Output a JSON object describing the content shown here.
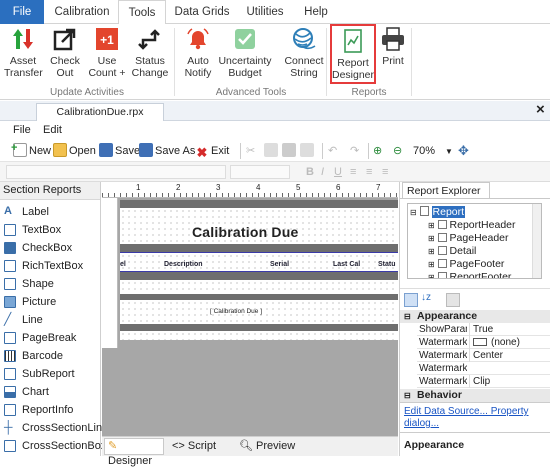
{
  "ribbon_tabs": [
    "File",
    "Calibration",
    "Tools",
    "Data Grids",
    "Utilities",
    "Help"
  ],
  "update_activities": {
    "buttons": [
      {
        "label1": "Asset",
        "label2": "Transfer",
        "icon": "up-down-arrows-icon"
      },
      {
        "label1": "Check",
        "label2": "Out",
        "icon": "check-out-icon"
      },
      {
        "label1": "Use",
        "label2": "Count +",
        "icon": "plus-one-icon"
      },
      {
        "label1": "Status",
        "label2": "Change",
        "icon": "status-change-icon"
      }
    ],
    "group_label": "Update Activities"
  },
  "advanced_tools": {
    "buttons": [
      {
        "label1": "Auto",
        "label2": "Notify",
        "icon": "bell-icon"
      },
      {
        "label1": "Uncertainty",
        "label2": "Budget",
        "icon": "budget-check-icon"
      },
      {
        "label1": "Connect",
        "label2": "String",
        "icon": "connect-string-icon"
      }
    ],
    "group_label": "Advanced Tools"
  },
  "reports": {
    "buttons": [
      {
        "label1": "Report",
        "label2": "Designer",
        "icon": "report-designer-icon"
      },
      {
        "label1": "Print",
        "label2": "",
        "icon": "printer-icon"
      }
    ],
    "group_label": "Reports"
  },
  "document_tab": "CalibrationDue.rpx",
  "close_glyph": "×",
  "menu": [
    "File",
    "Edit"
  ],
  "toolbar": {
    "new": "New",
    "open": "Open",
    "save": "Save",
    "save_as": "Save As",
    "exit": "Exit",
    "zoom": "70%"
  },
  "section_reports": {
    "title": "Section Reports",
    "items": [
      "Label",
      "TextBox",
      "CheckBox",
      "RichTextBox",
      "Shape",
      "Picture",
      "Line",
      "PageBreak",
      "Barcode",
      "SubReport",
      "Chart",
      "ReportInfo",
      "CrossSectionLine",
      "CrossSectionBox"
    ]
  },
  "canvas": {
    "ruler_numbers": [
      "1",
      "2",
      "3",
      "4",
      "5",
      "6",
      "7"
    ],
    "report_title": "Calibration Due",
    "columns": [
      "el",
      "Description",
      "Serial",
      "Last Cal",
      "Statu"
    ],
    "page_footer_field": "[ Calibration Due ]"
  },
  "bottom_tabs": {
    "designer": "Designer",
    "script": "Script",
    "preview": "Preview"
  },
  "explorer": {
    "tab": "Report Explorer",
    "root": "Report",
    "children": [
      "ReportHeader",
      "PageHeader",
      "Detail",
      "PageFooter",
      "ReportFooter"
    ]
  },
  "properties": {
    "category1": "Appearance",
    "rows": [
      {
        "k": "ShowParam",
        "v": "True"
      },
      {
        "k": "Watermark",
        "v": "(none)"
      },
      {
        "k": "WatermarkA",
        "v": "Center"
      },
      {
        "k": "WatermarkP",
        "v": ""
      },
      {
        "k": "WatermarkS",
        "v": "Clip"
      }
    ],
    "category2": "Behavior",
    "links": "Edit Data Source... Property dialog...",
    "desc_title": "Appearance"
  }
}
